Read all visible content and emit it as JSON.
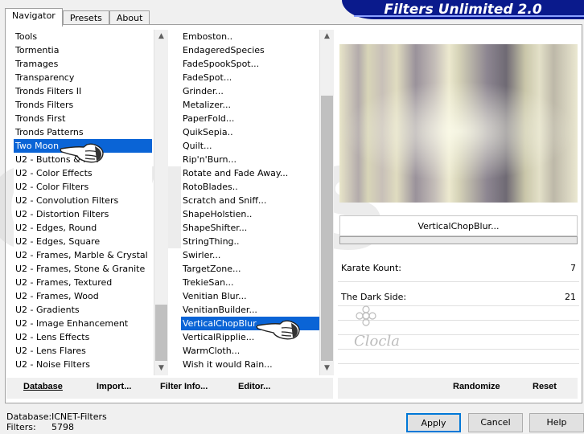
{
  "tabs": [
    {
      "label": "Navigator",
      "active": true
    },
    {
      "label": "Presets",
      "active": false
    },
    {
      "label": "About",
      "active": false
    }
  ],
  "header": {
    "title": "Filters Unlimited 2.0"
  },
  "categories": [
    "Tools",
    "Tormentia",
    "Tramages",
    "Transparency",
    "Tronds Filters II",
    "Tronds Filters",
    "Tronds First",
    "Tronds Patterns",
    "Two Moon",
    "U2 - Buttons & Fr...",
    "U2 - Color Effects",
    "U2 - Color Filters",
    "U2 - Convolution Filters",
    "U2 - Distortion Filters",
    "U2 - Edges, Round",
    "U2 - Edges, Square",
    "U2 - Frames, Marble & Crystal",
    "U2 - Frames, Stone & Granite",
    "U2 - Frames, Textured",
    "U2 - Frames, Wood",
    "U2 - Gradients",
    "U2 - Image Enhancement",
    "U2 - Lens Effects",
    "U2 - Lens Flares",
    "U2 - Noise Filters"
  ],
  "selected_category_index": 8,
  "filters": [
    "Emboston..",
    "EndageredSpecies",
    "FadeSpookSpot...",
    "FadeSpot...",
    "Grinder...",
    "Metalizer...",
    "PaperFold...",
    "QuikSepia..",
    "Quilt...",
    "Rip'n'Burn...",
    "Rotate and Fade Away...",
    "RotoBlades..",
    "Scratch and Sniff...",
    "ShapeHolstien..",
    "ShapeShifter...",
    "StringThing..",
    "Swirler...",
    "TargetZone...",
    "TrekieSan...",
    "Venitian Blur...",
    "VenitianBuilder...",
    "VerticalChopBlur...",
    "VerticalRipplie...",
    "WarmCloth...",
    "Wish it would Rain..."
  ],
  "selected_filter_index": 21,
  "filter_name": "VerticalChopBlur...",
  "params": [
    {
      "label": "Karate Kount:",
      "value": "7"
    },
    {
      "label": "The Dark Side:",
      "value": "21"
    }
  ],
  "toolbar": {
    "database": "Database",
    "import": "Import...",
    "filter_info": "Filter Info...",
    "editor": "Editor...",
    "randomize": "Randomize",
    "reset": "Reset"
  },
  "info": {
    "database_label": "Database:",
    "database_value": "ICNET-Filters",
    "filters_label": "Filters:",
    "filters_value": "5798"
  },
  "dialog": {
    "apply": "Apply",
    "cancel": "Cancel",
    "help": "Help"
  },
  "watermark": "OVERS",
  "signature": "Clocla",
  "colors": {
    "selection": "#0a64d6",
    "header_bg": "#0a1a8c",
    "default_button_border": "#0078d7"
  }
}
